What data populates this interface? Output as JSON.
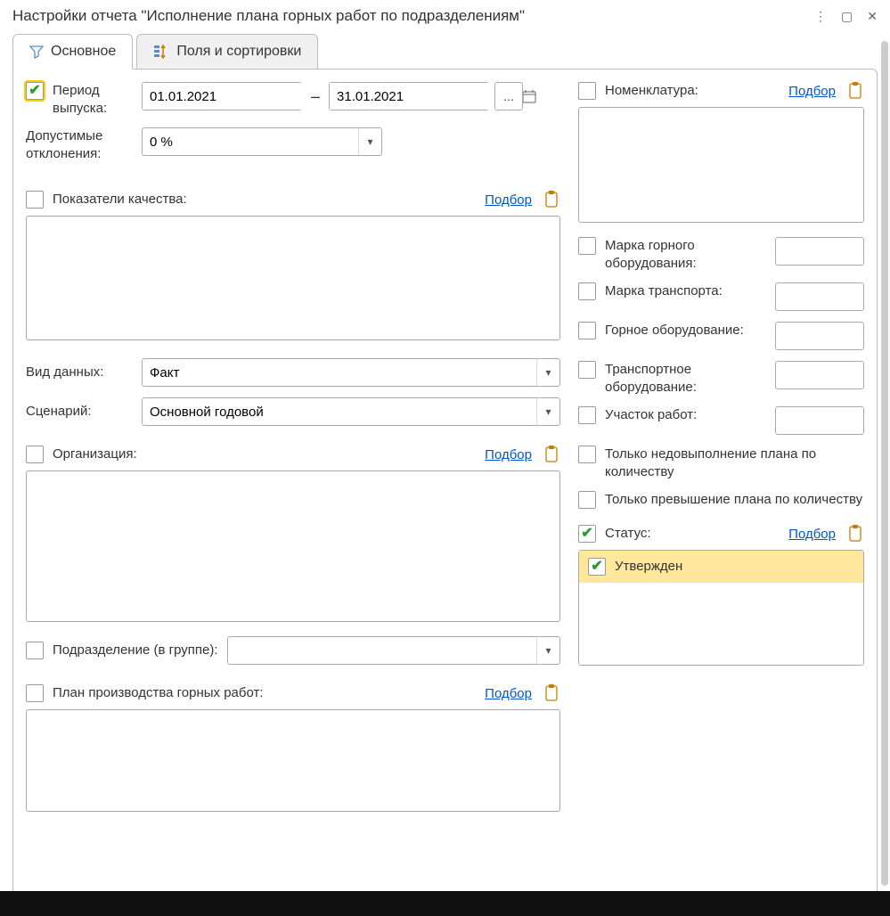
{
  "window": {
    "title": "Настройки отчета \"Исполнение плана горных работ по подразделениям\""
  },
  "tabs": {
    "main": "Основное",
    "fields": "Поля и сортировки"
  },
  "period": {
    "label": "Период выпуска:",
    "from": "01.01.2021",
    "to": "31.01.2021",
    "more": "..."
  },
  "deviation": {
    "label": "Допустимые отклонения:",
    "value": "0 %"
  },
  "quality": {
    "label": "Показатели качества:",
    "select": "Подбор"
  },
  "dataType": {
    "label": "Вид данных:",
    "value": "Факт"
  },
  "scenario": {
    "label": "Сценарий:",
    "value": "Основной годовой"
  },
  "organization": {
    "label": "Организация:",
    "select": "Подбор"
  },
  "division": {
    "label": "Подразделение (в группе):"
  },
  "plan": {
    "label": "План производства горных работ:",
    "select": "Подбор"
  },
  "nomenclature": {
    "label": "Номенклатура:",
    "select": "Подбор"
  },
  "miningBrand": {
    "label": "Марка горного оборудования:"
  },
  "transportBrand": {
    "label": "Марка транспорта:"
  },
  "miningEquip": {
    "label": "Горное оборудование:"
  },
  "transportEquip": {
    "label": "Транспортное оборудование:"
  },
  "workArea": {
    "label": "Участок работ:"
  },
  "onlyUnder": {
    "label": "Только недовыполнение плана по количеству"
  },
  "onlyOver": {
    "label": "Только превышение плана по количеству"
  },
  "status": {
    "label": "Статус:",
    "select": "Подбор",
    "item": "Утвержден"
  }
}
